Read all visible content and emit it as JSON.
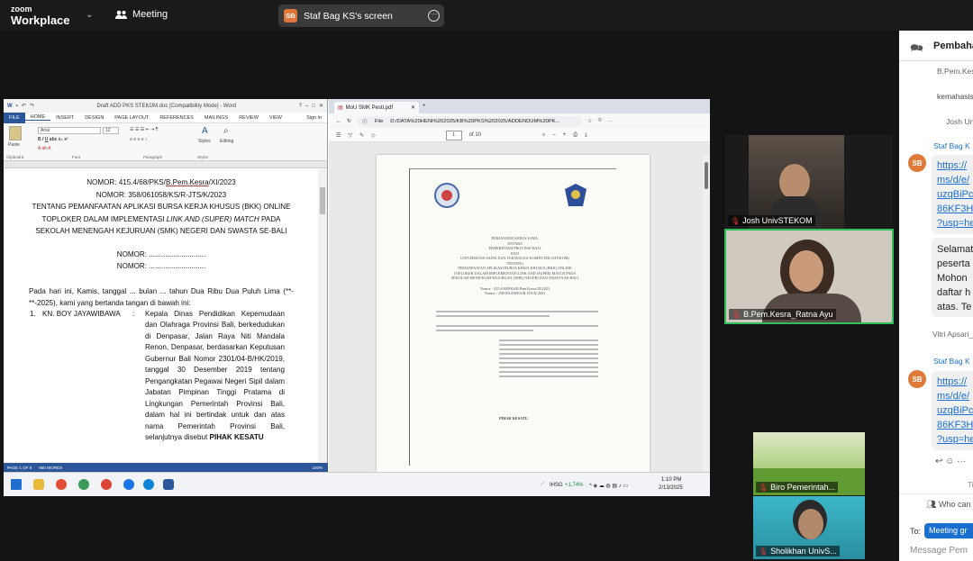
{
  "topbar": {
    "brand_line1": "zoom",
    "brand_line2": "Workplace",
    "meeting_label": "Meeting",
    "share_initials": "SB",
    "share_label": "Staf Bag KS's screen"
  },
  "word": {
    "title": "Draft ADD PKS STEKOM.doc [Compatibility Mode] - Word",
    "menu": [
      "FILE",
      "HOME",
      "INSERT",
      "DESIGN",
      "PAGE LAYOUT",
      "REFERENCES",
      "MAILINGS",
      "REVIEW",
      "VIEW",
      "Sign in"
    ],
    "ribbon": {
      "paste": "Paste",
      "font": "Arial",
      "size": "12",
      "styles": "Styles",
      "editing": "Editing",
      "clipboard": "Clipboard",
      "font_grp": "Font",
      "para_grp": "Paragraph",
      "styles_grp": "Styles"
    },
    "doc": {
      "line1_pre": "NOMOR: 415.4/68/PKS/",
      "line1_u": "B.Pem.Kesra",
      "line1_post": "/XI/2023",
      "line2": "NOMOR: 358/061058/KS/R-JTS/K/2023",
      "line3": "TENTANG PEMANFAATAN APLIKASI BURSA KERJA KHUSUS (BKK) ONLINE",
      "line4_pre": "TOPLOKER DALAM IMPLEMENTASI ",
      "line4_i": "LINK AND (SUPER) MATCH",
      "line4_post": " PADA",
      "line5": "SEKOLAH MENENGAH KEJURUAN (SMK) NEGERI DAN SWASTA SE-BALI",
      "nomor1": "NOMOR: ............................",
      "nomor2": "NOMOR: ............................",
      "opening": "Pada hari ini, Kamis, tanggal ... bulan ... tahun Dua Ribu Dua Puluh Lima (**-**-2025), kami yang bertanda tangan di bawah ini:",
      "party_num": "1.",
      "party_name": "KN. BOY JAYAWIBAWA",
      "party_colon": ":",
      "party_desc": "Kepala Dinas Pendidikan Kepemudaan dan Olahraga Provinsi Bali, berkedudukan di Denpasar, Jalan Raya Niti Mandala Renon, Denpasar, berdasarkan Keputusan Gubernur Bali Nomor 2301/04-B/HK/2019, tanggal 30 Desember 2019 tentang Pengangkatan Pegawai Negeri Sipil dalam Jabatan Pimpinan Tinggi Pratama di Lingkungan Pemerintah Provinsi Bali, dalam hal ini bertindak untuk dan atas nama Pemerintah Provinsi Bali, selanjutnya disebut ",
      "party_bold": "PIHAK KESATU"
    },
    "status": {
      "page": "PAGE 1 OF 5",
      "words": "950 WORDS",
      "zoom": "100%"
    }
  },
  "pdf": {
    "tab_title": "MoU SMK Pesti.pdf",
    "file_label": "File",
    "url": "D:/DATA%20HENI%202025/KB%20PKS%202025/ADDENDUM%20PK...",
    "page_current": "1",
    "page_total": "of 10",
    "page_text": {
      "h1": "PERJANJIAN KERJA SAMA",
      "h2": "ANTARA",
      "h3": "PEMERINTAH PROVINSI BALI",
      "h4": "DAN",
      "h5": "UNIVERSITAS SAINS DAN TEKNOLOGI KOMPUTER (STEKOM)",
      "h6": "TENTANG",
      "h7": "PEMANFAATAN APLIKASI BURSA KERJA KHUSUS (BKK) ONLINE",
      "h8": "TOPLOKER DALAM IMPLEMENTASI LINK AND (SUPER) MATCH PADA",
      "h9": "SEKOLAH MENENGAH KEJURUAN (SMK) NEGERI DAN SWASTA SE-BALI",
      "n1": "Nomor : 415.4/68/PKS/B.Pem.Kesra/XI/2023",
      "n2": "Nomor : 358/061058/KS/R-JTS/K/2023",
      "closing": "PIHAK KESATU."
    }
  },
  "taskbar": {
    "ihsg": "IHSG",
    "ihsg_change": "+1,74%",
    "time": "1:10 PM",
    "date": "2/13/2025"
  },
  "participants": [
    {
      "name": "Josh UnivSTEKOM"
    },
    {
      "name": "B.Pem.Kesra_Ratna  Ayu"
    },
    {
      "name": "Biro Pemerintah..."
    },
    {
      "name": "Sholikhan UnivS..."
    }
  ],
  "chat": {
    "title": "Pembaha",
    "sender1": "B.Pem.Kes",
    "msg1": "kemahasis",
    "sender_josh": "Josh Un",
    "sender2": "Staf Bag K",
    "initials": "SB",
    "link1": [
      "https://",
      "ms/d/e/",
      "uzqBiPc",
      "86KF3H",
      "?usp=he"
    ],
    "text_lines": [
      "Selamat",
      "peserta",
      "Mohon",
      "daftar h",
      "atas. Te"
    ],
    "sender3": "Vitri Apsari_",
    "sender4": "Staf Bag K",
    "link2": [
      "https://",
      "ms/d/e/",
      "uzqBiPc",
      "86KF3H",
      "?usp=he"
    ],
    "who_can": "Who can",
    "to_label": "To:",
    "to_value": "Meeting gr",
    "placeholder": "Message Pem"
  }
}
